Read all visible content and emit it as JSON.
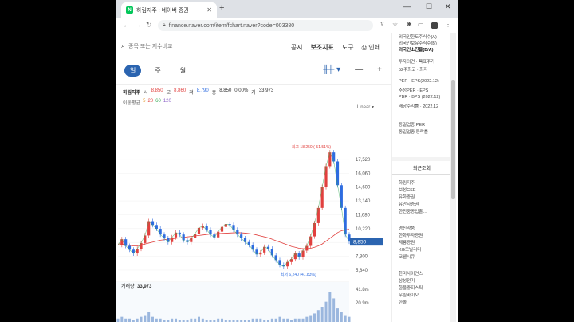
{
  "browser": {
    "tab_title": "하림지주 : 네이버 증권",
    "favicon": "N",
    "url": "finance.naver.com/item/fchart.naver?code=003380"
  },
  "toolbar": {
    "search_placeholder": "종목 또는 지수비교",
    "menu": [
      "공시",
      "보조지표",
      "도구",
      "인쇄"
    ],
    "periods": [
      "일",
      "주",
      "월"
    ],
    "active_period": "일"
  },
  "quote": {
    "name": "하림지주",
    "open_label": "시",
    "open": "8,850",
    "high_label": "고",
    "high": "8,860",
    "low_label": "저",
    "low": "8,790",
    "close_label": "종",
    "close": "8,850",
    "change": "0.00%",
    "volume_label": "거",
    "volume": "33,973"
  },
  "ma": {
    "label": "이동평균",
    "periods": [
      "5",
      "20",
      "60",
      "120"
    ]
  },
  "scale_label": "Linear",
  "chart_data": {
    "type": "line",
    "x_ticks": [
      "2월",
      "6월",
      "10월",
      "2022",
      "4월",
      "8월",
      "2023",
      "4월"
    ],
    "y_ticks": [
      17520,
      16060,
      14600,
      13140,
      11680,
      10220,
      8760,
      7300,
      5840
    ],
    "last_price": "8,850",
    "high_annotation": "최고 18,250 (-51.51%)",
    "low_annotation": "최저 6,240 (41.83%)",
    "volume_label": "거래량",
    "volume_value": "33,973",
    "volume_ticks": [
      "41.8m",
      "20.9m"
    ],
    "series_close": [
      8500,
      9100,
      8400,
      8000,
      7600,
      8100,
      8700,
      9500,
      11000,
      10600,
      10200,
      9600,
      9200,
      8800,
      9300,
      9800,
      9600,
      9000,
      8800,
      9200,
      9700,
      10300,
      10500,
      10100,
      9600,
      9300,
      9900,
      10400,
      10700,
      10600,
      10100,
      9600,
      9200,
      8800,
      8500,
      8000,
      7500,
      7700,
      8300,
      8100,
      7400,
      6900,
      6400,
      6240,
      6700,
      7000,
      7600,
      7200,
      7900,
      8400,
      9400,
      10800,
      12400,
      14600,
      16800,
      18250,
      17300,
      14800,
      12400,
      9600,
      8850
    ],
    "series_ma_long": [
      8600,
      8600,
      8500,
      8450,
      8400,
      8400,
      8500,
      8600,
      8700,
      8800,
      8900,
      9000,
      9050,
      9100,
      9150,
      9200,
      9250,
      9300,
      9350,
      9400,
      9450,
      9500,
      9550,
      9600,
      9650,
      9680,
      9700,
      9720,
      9740,
      9760,
      9780,
      9800,
      9780,
      9750,
      9700,
      9650,
      9550,
      9450,
      9350,
      9250,
      9100,
      8950,
      8800,
      8650,
      8500,
      8350,
      8250,
      8150,
      8100,
      8100,
      8150,
      8250,
      8400,
      8600,
      8900,
      9200,
      9500,
      9800,
      10000,
      10100,
      10150
    ],
    "volume": [
      2,
      3,
      2,
      2,
      1,
      2,
      3,
      4,
      6,
      3,
      2,
      2,
      1,
      1,
      2,
      2,
      1,
      1,
      1,
      2,
      2,
      3,
      2,
      1,
      1,
      1,
      2,
      2,
      1,
      1,
      1,
      1,
      1,
      1,
      1,
      2,
      2,
      2,
      1,
      1,
      2,
      2,
      3,
      2,
      2,
      1,
      2,
      2,
      2,
      3,
      4,
      5,
      7,
      9,
      12,
      18,
      14,
      8,
      6,
      4,
      3
    ]
  },
  "side": {
    "lines_top": [
      "외국인한도주식수(A)",
      "외국인보유주식수(B)",
      "외국인소진율(B/A)"
    ],
    "lines_mid": [
      "투자의견 · 목표주가",
      "52주최고 · 최저"
    ],
    "lines_per": [
      "PER · EPS(2022.12)",
      "추정PER · EPS",
      "PBR · BPS (2022.12)",
      "배당수익률 · 2022.12"
    ],
    "lines_ind": [
      "동일업종 PER",
      "동일업종 등락률"
    ],
    "recent_title": "최근조회",
    "recent_items": [
      "하림지주",
      "보성CSE",
      "유화증권",
      "유안타증권",
      "한진중공업홀…"
    ],
    "recent_items2": [
      "영진약품",
      "한화투자증권",
      "제룡증권",
      "KG모빌리티",
      "코웰시큐"
    ],
    "recent_items3": [
      "한미사이언스",
      "삼성전기",
      "한울증지스틱…",
      "우림바이오",
      "한솔"
    ]
  },
  "colors": {
    "accent": "#2b64b0",
    "up": "#e1403e",
    "down": "#2e6ce0"
  }
}
